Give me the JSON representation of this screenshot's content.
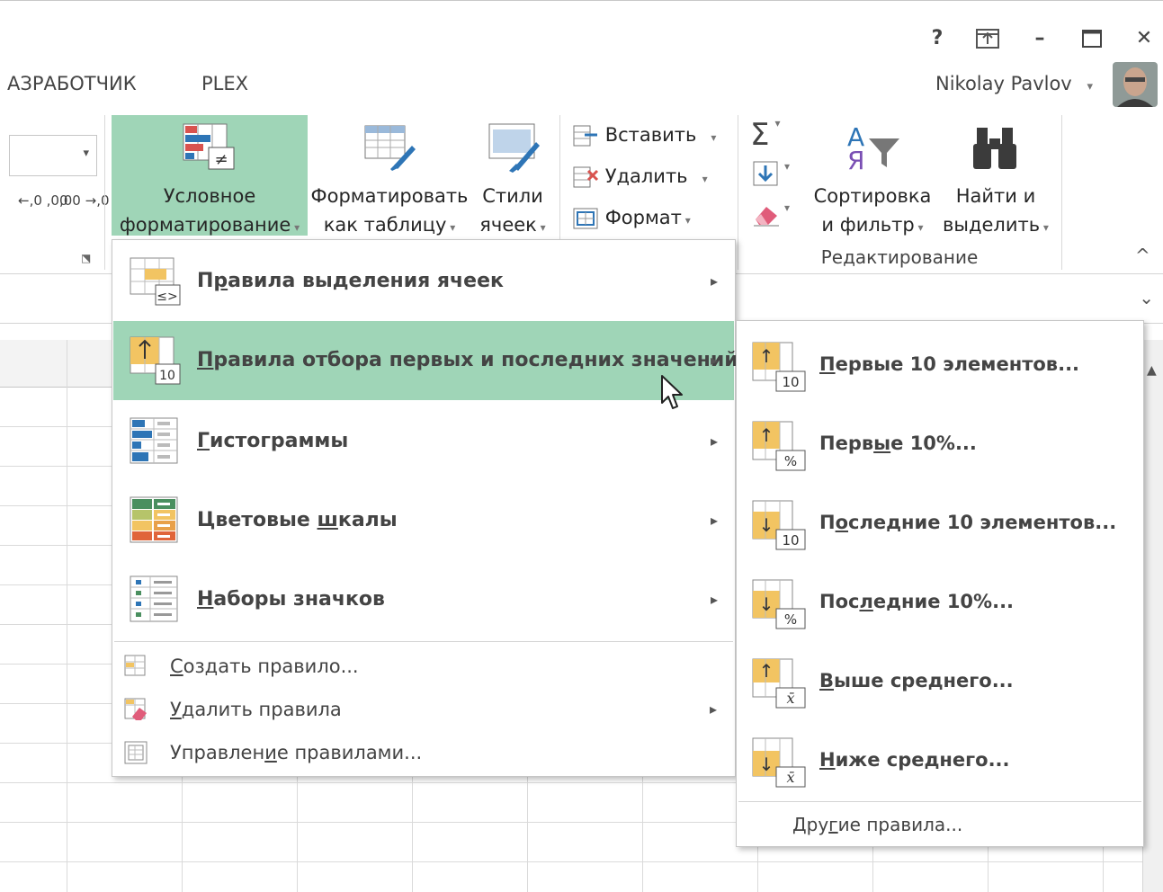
{
  "window": {
    "help": "?",
    "ribbon_display": "⤒",
    "minimize": "–",
    "maximize": "☐",
    "close": "✕"
  },
  "tabs": [
    "АЗРАБОТЧИК",
    "PLEX"
  ],
  "user": {
    "name": "Nikolay Pavlov",
    "dropdown": "▾"
  },
  "ribbon": {
    "number": {
      "dec_inc": "←,0 ,00",
      "dec_dec": ",00 →,0"
    },
    "conditional": {
      "line1": "Условное",
      "line2": "форматирование"
    },
    "as_table": {
      "line1": "Форматировать",
      "line2": "как таблицу"
    },
    "styles": {
      "line1": "Стили",
      "line2": "ячеек"
    },
    "cells": {
      "insert": "Вставить",
      "delete": "Удалить",
      "format": "Формат"
    },
    "editing": {
      "sum": "Σ",
      "sort_line1": "Сортировка",
      "sort_line2": "и фильтр",
      "find_line1": "Найти и",
      "find_line2": "выделить",
      "group_label": "Редактирование",
      "sort_glyph_a": "А",
      "sort_glyph_ya": "Я"
    },
    "collapse": "^"
  },
  "menu": {
    "items": [
      {
        "label_pre": "П",
        "label_u": "р",
        "label_post": "авила выделения ячеек",
        "icon": "highlight-cells-icon",
        "icon_text": "≤>"
      },
      {
        "label_pre": "",
        "label_u": "П",
        "label_post": "равила отбора первых и последних значений",
        "icon": "top-bottom-icon",
        "icon_text": "10"
      },
      {
        "label_pre": "",
        "label_u": "Г",
        "label_post": "истограммы",
        "icon": "data-bars-icon"
      },
      {
        "label_pre": "Цветовые ",
        "label_u": "ш",
        "label_post": "калы",
        "icon": "color-scales-icon"
      },
      {
        "label_pre": "",
        "label_u": "Н",
        "label_post": "аборы значков",
        "icon": "icon-sets-icon"
      }
    ],
    "arrow": "▸",
    "small": [
      {
        "label_pre": "",
        "label_u": "С",
        "label_post": "оздать правило..."
      },
      {
        "label_pre": "",
        "label_u": "У",
        "label_post": "далить правила"
      },
      {
        "label_pre": "Управлен",
        "label_u": "и",
        "label_post": "е правилами..."
      }
    ]
  },
  "submenu": {
    "items": [
      {
        "label_pre": "",
        "label_u": "П",
        "label_post": "ервые 10 элементов...",
        "badge": "10",
        "arrow": "↑"
      },
      {
        "label_pre": "Перв",
        "label_u": "ы",
        "label_post": "е 10%...",
        "badge": "%",
        "arrow": "↑"
      },
      {
        "label_pre": "П",
        "label_u": "о",
        "label_post": "следние 10 элементов...",
        "badge": "10",
        "arrow": "↓"
      },
      {
        "label_pre": "Пос",
        "label_u": "л",
        "label_post": "едние 10%...",
        "badge": "%",
        "arrow": "↓"
      },
      {
        "label_pre": "",
        "label_u": "В",
        "label_post": "ыше среднего...",
        "badge": "x̄",
        "arrow": "↑"
      },
      {
        "label_pre": "",
        "label_u": "Н",
        "label_post": "иже среднего...",
        "badge": "x̄",
        "arrow": "↓"
      }
    ],
    "other": {
      "label_pre": "Дру",
      "label_u": "г",
      "label_post": "ие правила..."
    }
  },
  "colors": {
    "highlight": "#9fd5b7",
    "ribbon_active": "#9fd5b7",
    "accent_blue": "#2e75b6"
  }
}
